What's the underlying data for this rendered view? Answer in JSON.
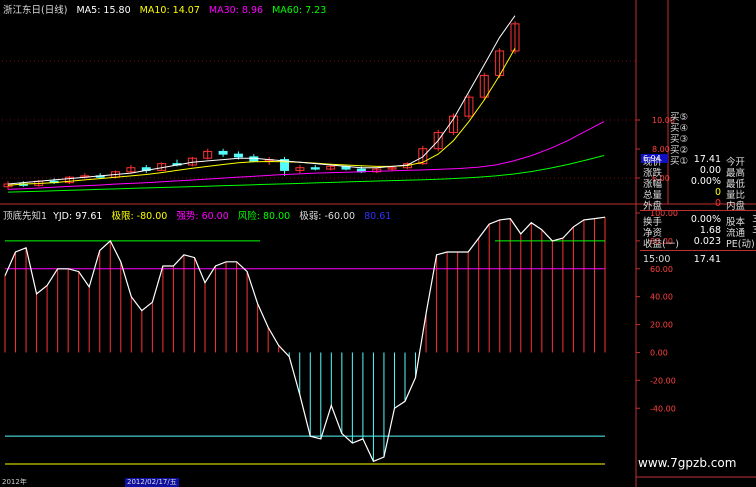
{
  "header_top": {
    "title": "浙江东日(日线)",
    "ma5": "MA5: 15.80",
    "ma10": "MA10: 14.07",
    "ma30": "MA30: 8.96",
    "ma60": "MA60: 7.23"
  },
  "header_bottom": {
    "name": "顶底先知1",
    "yjd": "YJD: 97.61",
    "jixian": "极限: -80.00",
    "qiangshi": "强势: 60.00",
    "fengxian": "风险: 80.00",
    "jiruo": "极弱: -60.00",
    "extra": "80.61"
  },
  "price_axis": {
    "labels": [
      "10.00",
      "8.00",
      "6.00"
    ],
    "current_price_tag": "6.94"
  },
  "indicator_axis": {
    "labels": [
      "100.00",
      "80.00",
      "60.00",
      "40.00",
      "20.00",
      "0.00",
      "-20.00",
      "-40.00"
    ]
  },
  "buy_labels": [
    "买⑤",
    "买④",
    "买③",
    "买②",
    "买①"
  ],
  "quote": {
    "rows": [
      {
        "l": "现价",
        "v": "17.41",
        "r": "今开",
        "vc": "#ffffff"
      },
      {
        "l": "涨跌",
        "v": "0.00",
        "r": "最高",
        "vc": "#ffffff"
      },
      {
        "l": "涨幅",
        "v": "0.00%",
        "r": "最低",
        "vc": "#ffffff"
      },
      {
        "l": "总量",
        "v": "0",
        "r": "量比",
        "vc": "#ffff00"
      },
      {
        "l": "外盘",
        "v": "0",
        "r": "内盘",
        "vc": "#ff3030"
      },
      {
        "l": "换手",
        "v": "0.00%",
        "r": "股本",
        "vc": "#ffffff"
      },
      {
        "l": "净资",
        "v": "1.68",
        "r": "流通",
        "vc": "#ffffff"
      },
      {
        "l": "收益(一)",
        "v": "0.023",
        "r": "PE(动)",
        "vc": "#ffffff"
      }
    ],
    "extra_right": [
      "3",
      "3"
    ],
    "time": "15:00",
    "time_price": "17.41"
  },
  "watermark": "www.7gpzb.com",
  "date_bar": {
    "left": "2012年",
    "mid": "2012/02/17/五"
  },
  "colors": {
    "up": "#ff3232",
    "down": "#54fcfc",
    "ma5": "#ffffff",
    "ma10": "#ffff00",
    "ma30": "#ff00ff",
    "ma60": "#00ff00",
    "yjd_line": "#ffffff",
    "level_80": "#00ff00",
    "level_60": "#ff00ff",
    "level_n60": "#54fcfc",
    "level_n80": "#ffff00"
  },
  "chart_data": [
    {
      "type": "candlestick",
      "title": "浙江东日(日线)",
      "ylim": [
        4.5,
        11.5
      ],
      "series_ma": {
        "ma5": [
          5.2,
          5.25,
          5.3,
          5.35,
          5.4,
          5.45,
          5.5,
          5.55,
          5.6,
          5.7,
          5.8,
          5.9,
          6.0,
          6.05,
          6.1,
          6.15,
          6.15,
          6.1,
          6.05,
          6.0,
          5.95,
          5.9,
          5.85,
          5.8,
          5.8,
          5.85,
          5.9,
          6.2,
          6.8,
          7.6,
          8.6,
          9.6,
          10.6,
          11.4
        ],
        "ma10": [
          5.15,
          5.2,
          5.22,
          5.25,
          5.3,
          5.35,
          5.4,
          5.45,
          5.5,
          5.55,
          5.62,
          5.7,
          5.78,
          5.85,
          5.92,
          5.98,
          6.02,
          6.03,
          6.02,
          6.0,
          5.97,
          5.93,
          5.9,
          5.87,
          5.85,
          5.85,
          5.88,
          6.0,
          6.3,
          6.8,
          7.5,
          8.3,
          9.2,
          10.2
        ],
        "ma30": [
          5.0,
          5.03,
          5.06,
          5.1,
          5.13,
          5.16,
          5.2,
          5.23,
          5.26,
          5.3,
          5.34,
          5.38,
          5.42,
          5.46,
          5.5,
          5.54,
          5.57,
          5.6,
          5.62,
          5.64,
          5.66,
          5.68,
          5.7,
          5.72,
          5.74,
          5.77,
          5.82,
          5.9,
          6.05,
          6.25,
          6.5,
          6.8,
          7.15,
          7.5
        ],
        "ma60": [
          4.9,
          4.92,
          4.94,
          4.96,
          4.98,
          5.0,
          5.02,
          5.04,
          5.06,
          5.08,
          5.1,
          5.12,
          5.14,
          5.16,
          5.18,
          5.2,
          5.22,
          5.24,
          5.26,
          5.28,
          5.3,
          5.32,
          5.34,
          5.36,
          5.38,
          5.41,
          5.45,
          5.5,
          5.57,
          5.66,
          5.78,
          5.92,
          6.08,
          6.25
        ]
      },
      "candles": [
        [
          5.1,
          5.3,
          5.0,
          5.2
        ],
        [
          5.2,
          5.3,
          5.1,
          5.15
        ],
        [
          5.15,
          5.35,
          5.1,
          5.3
        ],
        [
          5.3,
          5.4,
          5.2,
          5.25
        ],
        [
          5.25,
          5.5,
          5.2,
          5.45
        ],
        [
          5.45,
          5.6,
          5.4,
          5.5
        ],
        [
          5.5,
          5.6,
          5.4,
          5.45
        ],
        [
          5.45,
          5.7,
          5.4,
          5.65
        ],
        [
          5.65,
          5.9,
          5.6,
          5.8
        ],
        [
          5.8,
          5.9,
          5.6,
          5.7
        ],
        [
          5.7,
          6.0,
          5.7,
          5.95
        ],
        [
          5.95,
          6.1,
          5.85,
          5.9
        ],
        [
          5.9,
          6.2,
          5.85,
          6.15
        ],
        [
          6.15,
          6.5,
          6.1,
          6.4
        ],
        [
          6.4,
          6.5,
          6.2,
          6.3
        ],
        [
          6.3,
          6.4,
          6.1,
          6.2
        ],
        [
          6.2,
          6.3,
          6.0,
          6.05
        ],
        [
          6.05,
          6.2,
          5.9,
          6.1
        ],
        [
          6.1,
          6.2,
          5.5,
          5.7
        ],
        [
          5.7,
          5.9,
          5.6,
          5.8
        ],
        [
          5.8,
          5.9,
          5.7,
          5.75
        ],
        [
          5.75,
          5.9,
          5.7,
          5.85
        ],
        [
          5.85,
          5.9,
          5.7,
          5.75
        ],
        [
          5.75,
          5.85,
          5.6,
          5.65
        ],
        [
          5.65,
          5.8,
          5.6,
          5.75
        ],
        [
          5.75,
          5.85,
          5.7,
          5.8
        ],
        [
          5.8,
          6.0,
          5.75,
          5.95
        ],
        [
          5.95,
          6.6,
          5.9,
          6.5
        ],
        [
          6.5,
          7.2,
          6.4,
          7.1
        ],
        [
          7.1,
          7.8,
          7.0,
          7.7
        ],
        [
          7.7,
          8.5,
          7.6,
          8.4
        ],
        [
          8.4,
          9.3,
          8.3,
          9.2
        ],
        [
          9.2,
          10.2,
          9.1,
          10.1
        ],
        [
          10.1,
          11.2,
          10.0,
          11.1
        ]
      ]
    },
    {
      "type": "line",
      "title": "顶底先知1",
      "ylim": [
        -60,
        100
      ],
      "levels": [
        80,
        60,
        -60,
        -80
      ],
      "yjd": [
        55,
        72,
        75,
        42,
        48,
        60,
        60,
        58,
        47,
        73,
        80,
        65,
        40,
        30,
        36,
        62,
        62,
        70,
        68,
        50,
        62,
        65,
        65,
        58,
        35,
        18,
        5,
        -3,
        -30,
        -60,
        -62,
        -38,
        -58,
        -65,
        -62,
        -78,
        -75,
        -40,
        -35,
        -18,
        28,
        70,
        72,
        72,
        72,
        82,
        92,
        95,
        96,
        85,
        93,
        88,
        80,
        82,
        90,
        95,
        96,
        97
      ],
      "bars_from": 0
    }
  ]
}
